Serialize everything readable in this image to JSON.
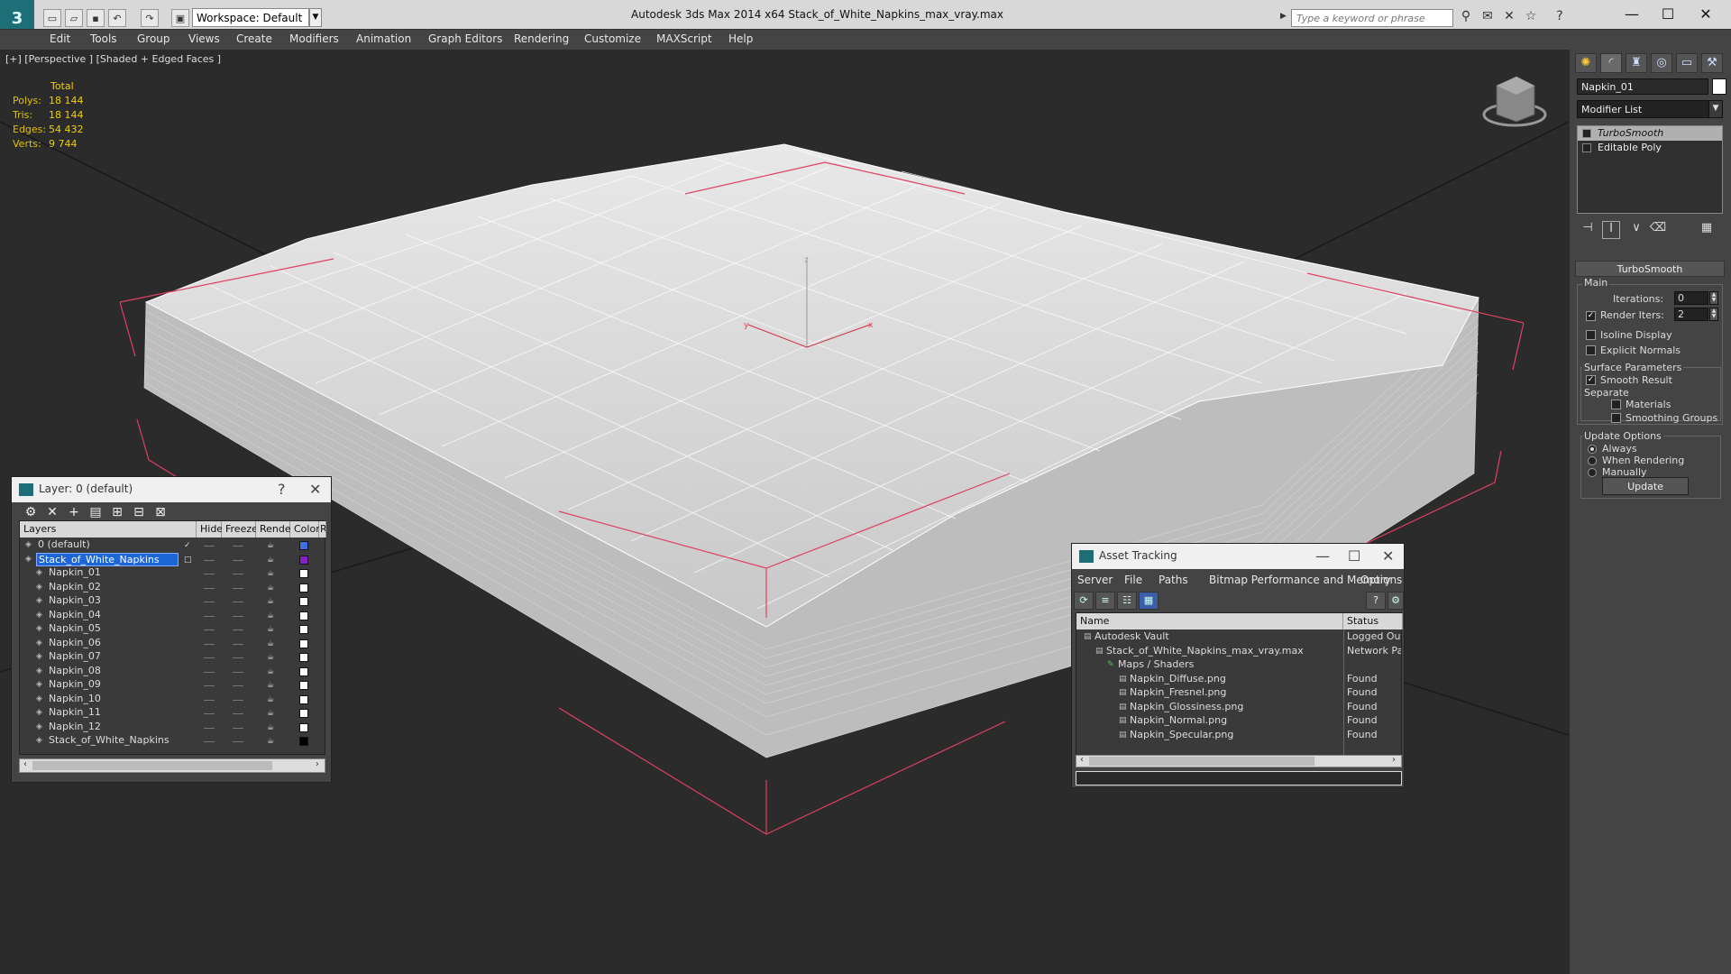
{
  "app": {
    "title": "Autodesk 3ds Max  2014 x64     Stack_of_White_Napkins_max_vray.max",
    "workspace": "Workspace: Default",
    "search_placeholder": "Type a keyword or phrase",
    "logo": "3"
  },
  "menu": [
    "Edit",
    "Tools",
    "Group",
    "Views",
    "Create",
    "Modifiers",
    "Animation",
    "Graph Editors",
    "Rendering",
    "Customize",
    "MAXScript",
    "Help"
  ],
  "viewport": {
    "label": "[+] [Perspective ] [Shaded + Edged Faces ]",
    "stats": {
      "header": "Total",
      "rows": [
        {
          "label": "Polys:",
          "value": "18 144"
        },
        {
          "label": "Tris:",
          "value": "18 144"
        },
        {
          "label": "Edges:",
          "value": "54 432"
        },
        {
          "label": "Verts:",
          "value": "9 744"
        }
      ]
    },
    "axis": {
      "x": "x",
      "y": "y",
      "z": "z"
    }
  },
  "command_panel": {
    "object_name": "Napkin_01",
    "modifier_list": "Modifier List",
    "stack": [
      {
        "label": "TurboSmooth",
        "selected": true
      },
      {
        "label": "Editable Poly",
        "selected": false
      }
    ],
    "rollout": {
      "title": "TurboSmooth",
      "main_label": "Main",
      "iterations_label": "Iterations:",
      "iterations": "0",
      "render_iters_label": "Render Iters:",
      "render_iters": "2",
      "isoline": "Isoline Display",
      "explicit_normals": "Explicit Normals",
      "surface_label": "Surface Parameters",
      "smooth_result": "Smooth Result",
      "separate_label": "Separate",
      "materials": "Materials",
      "smoothing_groups": "Smoothing Groups",
      "update_label": "Update Options",
      "always": "Always",
      "when_rendering": "When Rendering",
      "manually": "Manually",
      "update_button": "Update"
    }
  },
  "layer_panel": {
    "title": "Layer: 0 (default)",
    "help": "?",
    "close": "✕",
    "columns": [
      "Layers",
      "Hide",
      "Freeze",
      "Render",
      "Color",
      "R"
    ],
    "rows": [
      {
        "name": "0 (default)",
        "indent": 1,
        "check": "✓",
        "color": "#3a73e0",
        "selected": false
      },
      {
        "name": "Stack_of_White_Napkins",
        "indent": 1,
        "check": "□",
        "color": "#8a1fc4",
        "selected": true
      },
      {
        "name": "Napkin_01",
        "indent": 2,
        "check": "",
        "color": "#ffffff",
        "selected": false
      },
      {
        "name": "Napkin_02",
        "indent": 2,
        "check": "",
        "color": "#ffffff",
        "selected": false
      },
      {
        "name": "Napkin_03",
        "indent": 2,
        "check": "",
        "color": "#ffffff",
        "selected": false
      },
      {
        "name": "Napkin_04",
        "indent": 2,
        "check": "",
        "color": "#ffffff",
        "selected": false
      },
      {
        "name": "Napkin_05",
        "indent": 2,
        "check": "",
        "color": "#ffffff",
        "selected": false
      },
      {
        "name": "Napkin_06",
        "indent": 2,
        "check": "",
        "color": "#ffffff",
        "selected": false
      },
      {
        "name": "Napkin_07",
        "indent": 2,
        "check": "",
        "color": "#ffffff",
        "selected": false
      },
      {
        "name": "Napkin_08",
        "indent": 2,
        "check": "",
        "color": "#ffffff",
        "selected": false
      },
      {
        "name": "Napkin_09",
        "indent": 2,
        "check": "",
        "color": "#ffffff",
        "selected": false
      },
      {
        "name": "Napkin_10",
        "indent": 2,
        "check": "",
        "color": "#ffffff",
        "selected": false
      },
      {
        "name": "Napkin_11",
        "indent": 2,
        "check": "",
        "color": "#ffffff",
        "selected": false
      },
      {
        "name": "Napkin_12",
        "indent": 2,
        "check": "",
        "color": "#ffffff",
        "selected": false
      },
      {
        "name": "Stack_of_White_Napkins",
        "indent": 2,
        "check": "",
        "color": "#000000",
        "selected": false
      }
    ]
  },
  "asset_panel": {
    "title": "Asset Tracking",
    "menu": [
      "Server",
      "File",
      "Paths",
      "Bitmap Performance and Memory",
      "Options"
    ],
    "columns": [
      "Name",
      "Status"
    ],
    "rows": [
      {
        "name": "Autodesk Vault",
        "indent": 1,
        "status": "Logged Out ..."
      },
      {
        "name": "Stack_of_White_Napkins_max_vray.max",
        "indent": 2,
        "status": "Network Path"
      },
      {
        "name": "Maps / Shaders",
        "indent": 3,
        "status": ""
      },
      {
        "name": "Napkin_Diffuse.png",
        "indent": 4,
        "status": "Found"
      },
      {
        "name": "Napkin_Fresnel.png",
        "indent": 4,
        "status": "Found"
      },
      {
        "name": "Napkin_Glossiness.png",
        "indent": 4,
        "status": "Found"
      },
      {
        "name": "Napkin_Normal.png",
        "indent": 4,
        "status": "Found"
      },
      {
        "name": "Napkin_Specular.png",
        "indent": 4,
        "status": "Found"
      }
    ]
  }
}
